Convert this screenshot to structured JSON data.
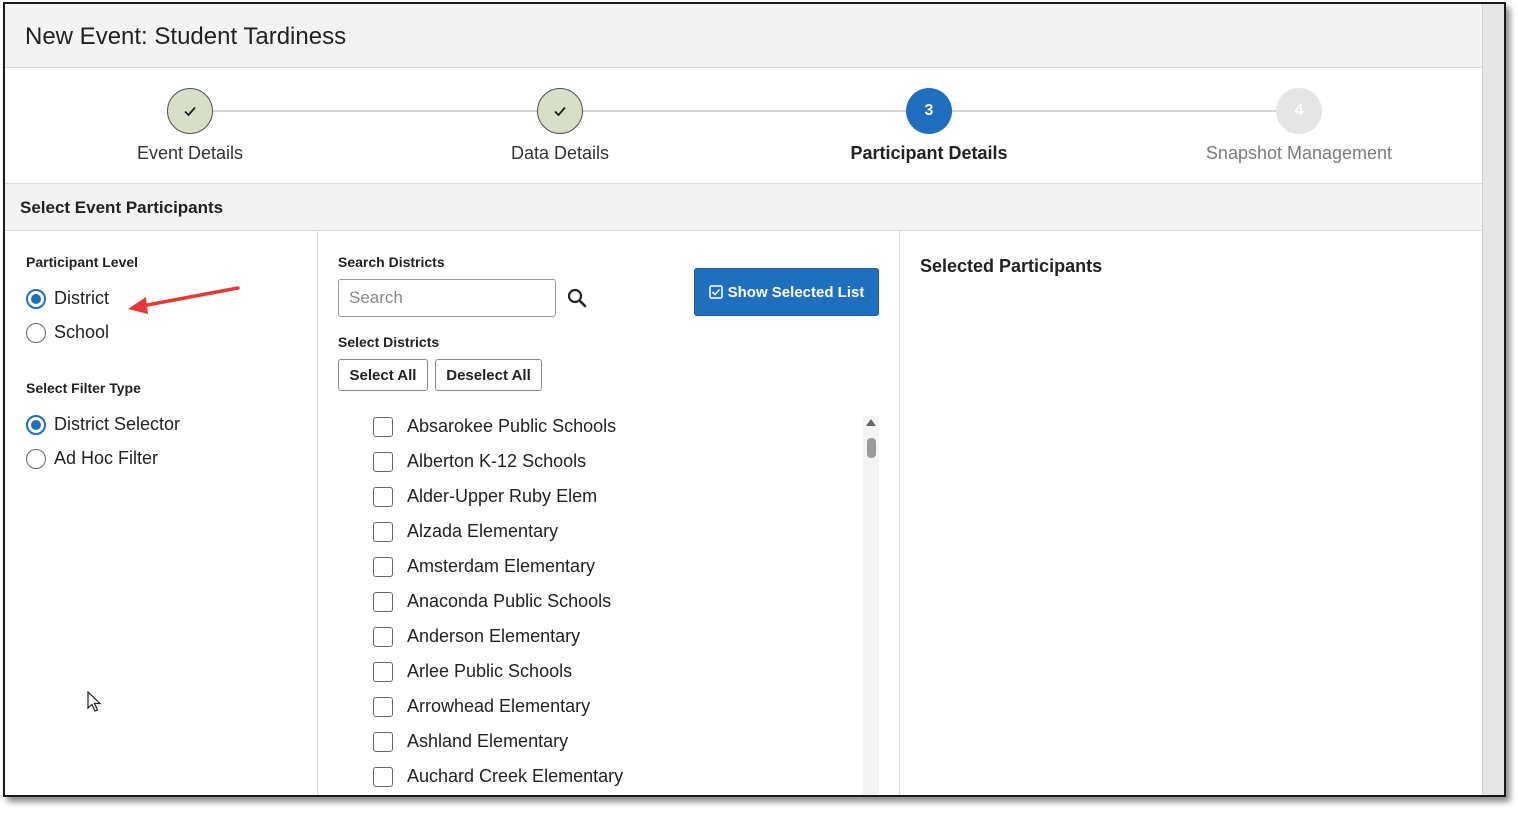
{
  "window": {
    "title": "New Event: Student Tardiness"
  },
  "stepper": {
    "steps": [
      {
        "number": "1",
        "label": "Event Details",
        "state": "done"
      },
      {
        "number": "2",
        "label": "Data Details",
        "state": "done"
      },
      {
        "number": "3",
        "label": "Participant Details",
        "state": "active"
      },
      {
        "number": "4",
        "label": "Snapshot Management",
        "state": "pending"
      }
    ]
  },
  "section": {
    "title": "Select Event Participants"
  },
  "participant_level": {
    "label": "Participant Level",
    "options": [
      {
        "label": "District",
        "checked": true
      },
      {
        "label": "School",
        "checked": false
      }
    ]
  },
  "filter_type": {
    "label": "Select Filter Type",
    "options": [
      {
        "label": "District Selector",
        "checked": true
      },
      {
        "label": "Ad Hoc Filter",
        "checked": false
      }
    ]
  },
  "search": {
    "label": "Search Districts",
    "placeholder": "Search",
    "value": ""
  },
  "select_districts": {
    "label": "Select Districts",
    "select_all_label": "Select All",
    "deselect_all_label": "Deselect All",
    "items": [
      "Absarokee Public Schools",
      "Alberton K-12 Schools",
      "Alder-Upper Ruby Elem",
      "Alzada Elementary",
      "Amsterdam Elementary",
      "Anaconda Public Schools",
      "Anderson Elementary",
      "Arlee Public Schools",
      "Arrowhead Elementary",
      "Ashland Elementary",
      "Auchard Creek Elementary"
    ]
  },
  "show_selected_button": {
    "label": "Show Selected List",
    "icon": "checkbox-icon"
  },
  "selected_panel": {
    "title": "Selected Participants"
  },
  "colors": {
    "primary": "#1f6fbf",
    "done_step": "#d7dfc8",
    "pending_step": "#e5e5e5",
    "annotation": "#e53935"
  }
}
